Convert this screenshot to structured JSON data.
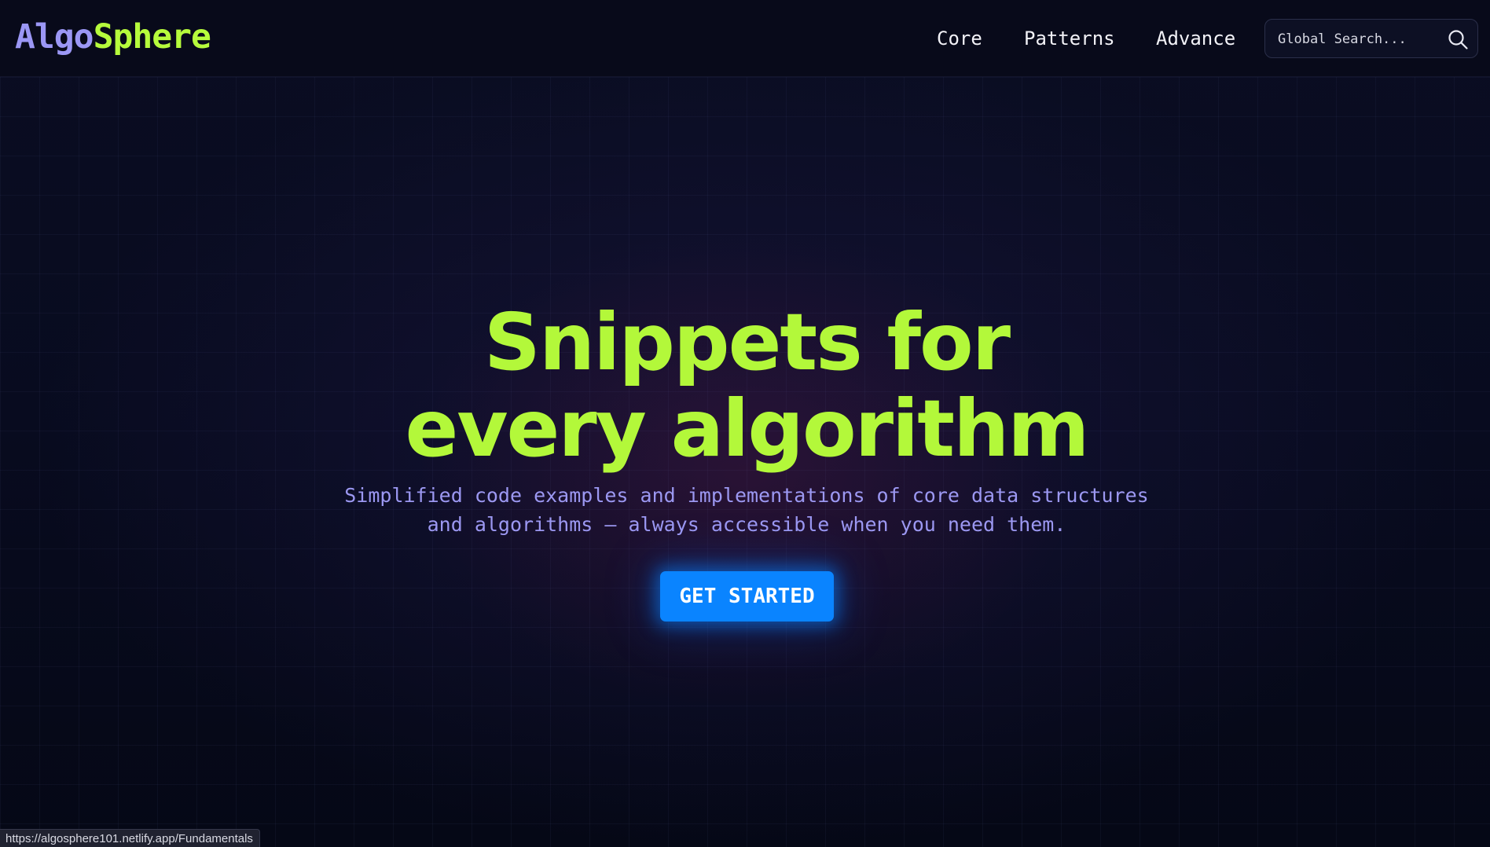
{
  "brand": {
    "logo_part1": "Algo",
    "logo_part2": "Sphere",
    "colors": {
      "algo": "#9b97f5",
      "sphere": "#b6fb3c"
    }
  },
  "nav": {
    "items": [
      {
        "label": "Core"
      },
      {
        "label": "Patterns"
      },
      {
        "label": "Advance"
      }
    ]
  },
  "search": {
    "placeholder": "Global Search...",
    "icon": "search-icon"
  },
  "hero": {
    "title_line1": "Snippets for",
    "title_line2": "every algorithm",
    "subtitle_line1": "Simplified code examples and implementations of core data structures",
    "subtitle_line2": "and algorithms — always accessible when you need them.",
    "cta_label": "GET STARTED",
    "colors": {
      "title": "#b3f83a",
      "subtitle": "#9c98f2",
      "cta": "#0a84ff"
    }
  },
  "status_bar": {
    "url": "https://algosphere101.netlify.app/Fundamentals"
  }
}
